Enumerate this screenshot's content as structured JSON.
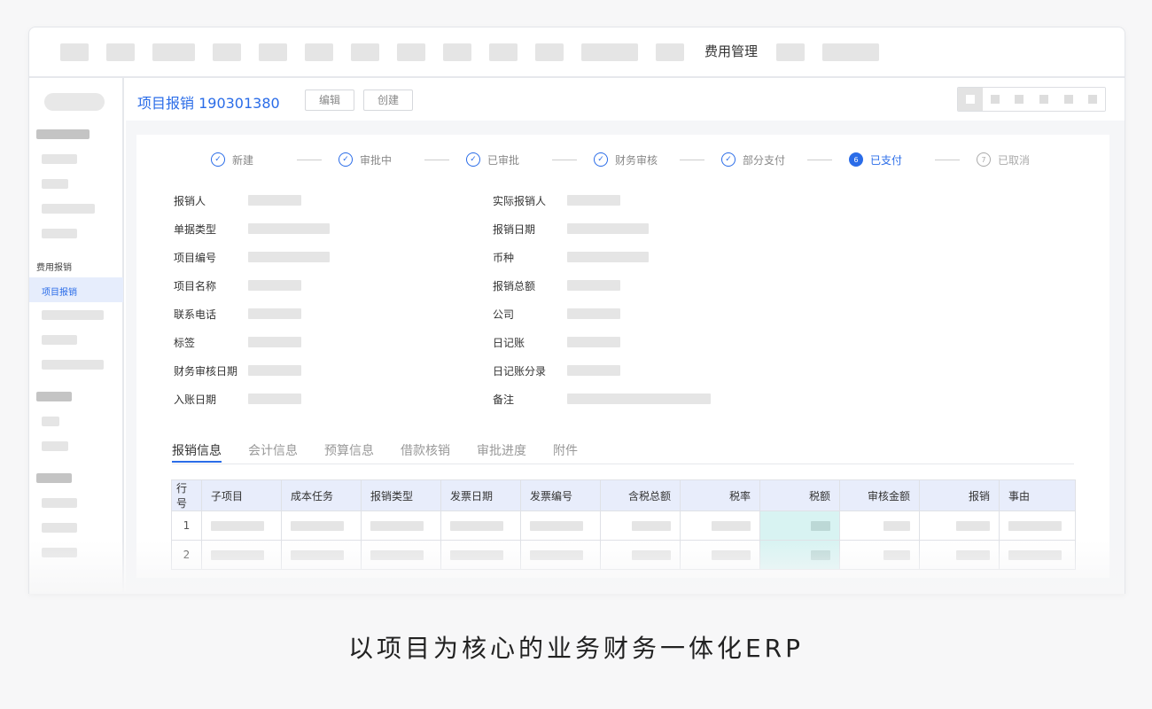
{
  "top_nav": {
    "active_label": "费用管理"
  },
  "sidebar": {
    "section_label": "费用报销",
    "active_item": "项目报销"
  },
  "header": {
    "title": "项目报销 190301380",
    "edit_label": "编辑",
    "create_label": "创建"
  },
  "steps": [
    {
      "label": "新建",
      "state": "done",
      "icon": "check-icon"
    },
    {
      "label": "审批中",
      "state": "done",
      "icon": "check-icon"
    },
    {
      "label": "已审批",
      "state": "done",
      "icon": "check-icon"
    },
    {
      "label": "财务审核",
      "state": "done",
      "icon": "check-icon"
    },
    {
      "label": "部分支付",
      "state": "done",
      "icon": "check-icon"
    },
    {
      "label": "已支付",
      "state": "current",
      "number": "6"
    },
    {
      "label": "已取消",
      "state": "pending",
      "number": "7"
    }
  ],
  "fields_left": [
    "报销人",
    "单据类型",
    "项目编号",
    "项目名称",
    "联系电话",
    "标签",
    "财务审核日期",
    "入账日期"
  ],
  "fields_right": [
    "实际报销人",
    "报销日期",
    "币种",
    "报销总额",
    "公司",
    "日记账",
    "日记账分录",
    "备注"
  ],
  "tabs": [
    "报销信息",
    "会计信息",
    "预算信息",
    "借款核销",
    "审批进度",
    "附件"
  ],
  "table": {
    "columns": [
      "行号",
      "子项目",
      "成本任务",
      "报销类型",
      "发票日期",
      "发票编号",
      "含税总额",
      "税率",
      "税额",
      "审核金额",
      "报销",
      "事由"
    ],
    "rows": [
      {
        "index": "1"
      },
      {
        "index": "2"
      }
    ]
  },
  "caption": "以项目为核心的业务财务一体化ERP",
  "colors": {
    "accent": "#2a6ce8",
    "highlight_column": "#d8f3f2",
    "table_header": "#e8edfb"
  }
}
